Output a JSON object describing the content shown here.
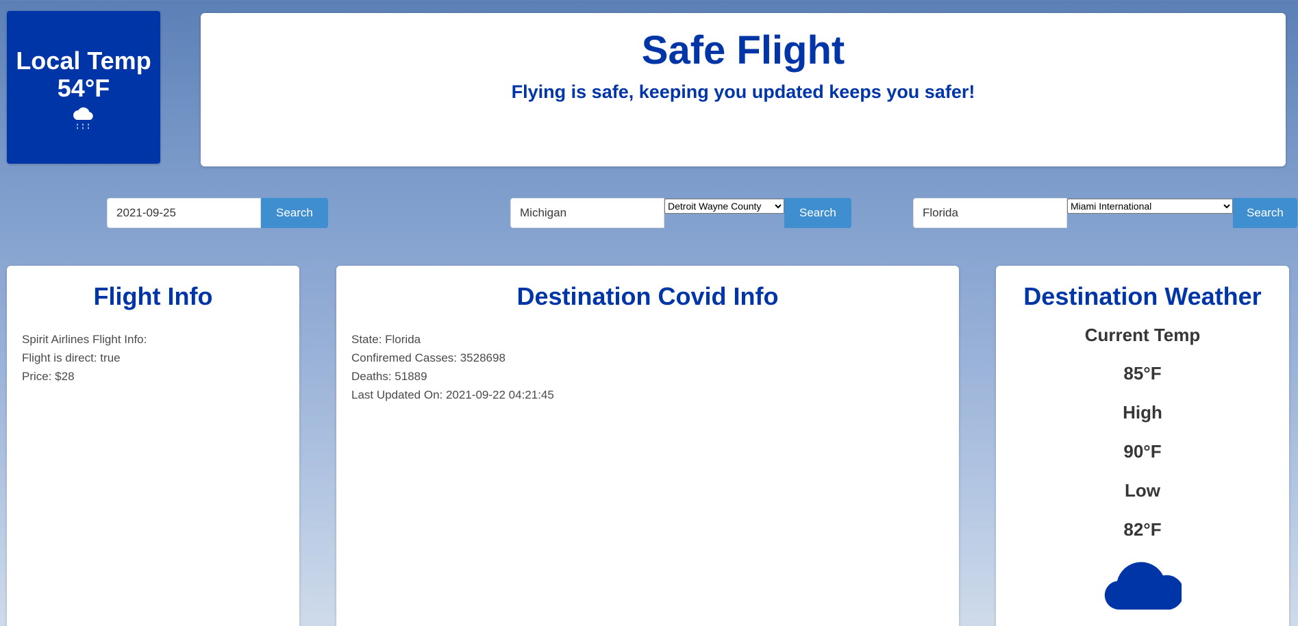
{
  "local": {
    "title": "Local Temp",
    "temp": "54°F",
    "icon": "rain-cloud-icon"
  },
  "hero": {
    "title": "Safe Flight",
    "subtitle": "Flying is safe, keeping you updated keeps you safer!"
  },
  "date_search": {
    "value": "2021-09-25",
    "button": "Search"
  },
  "origin_search": {
    "value": "Michigan",
    "selected": "Detroit Wayne County",
    "button": "Search"
  },
  "dest_search": {
    "value": "Florida",
    "selected": "Miami International",
    "button": "Search"
  },
  "flight_info": {
    "title": "Flight Info",
    "lines": [
      "Spirit Airlines Flight Info:",
      "Flight is direct: true",
      "Price: $28"
    ]
  },
  "covid_info": {
    "title": "Destination Covid Info",
    "lines": [
      "State: Florida",
      "Confiremed Casses: 3528698",
      "Deaths: 51889",
      "Last Updated On: 2021-09-22 04:21:45"
    ]
  },
  "weather": {
    "title": "Destination Weather",
    "current_label": "Current Temp",
    "current": "85°F",
    "high_label": "High",
    "high": "90°F",
    "low_label": "Low",
    "low": "82°F",
    "icon": "cloud-icon"
  },
  "colors": {
    "brand_blue": "#0035a8",
    "button_blue": "#3e8ed0"
  }
}
